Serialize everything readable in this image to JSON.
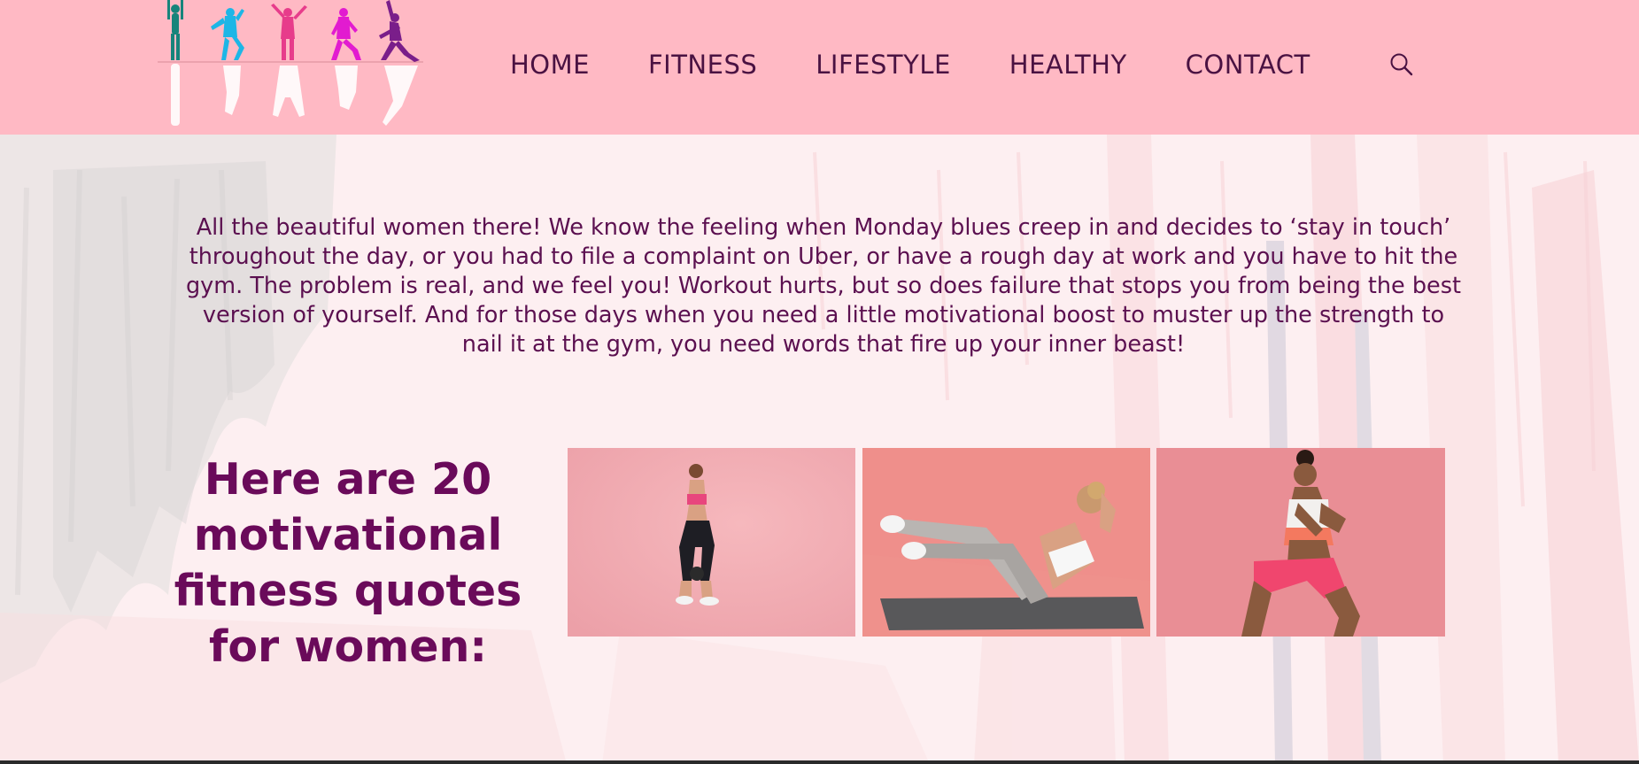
{
  "header": {
    "nav": [
      "HOME",
      "FITNESS",
      "LIFESTYLE",
      "HEALTHY",
      "CONTACT"
    ],
    "search_icon": "search-icon",
    "logo_icon": "fitness-silhouettes-logo"
  },
  "intro": {
    "text": "All the beautiful women there! We know the feeling when Monday blues creep in and decides to ‘stay in touch’ throughout the day, or you had to file a complaint on Uber, or have a rough day at work and you have to hit the gym. The problem is real, and we feel you! Workout hurts, but so does failure that stops you from being the best version of yourself. And for those days when you need a little motivational boost to muster up the strength to nail it at the gym, you need words that fire up your inner beast!"
  },
  "heading": {
    "text": "Here are 20 motivational fitness quotes for women:"
  },
  "colors": {
    "header_bg": "#ffb9c4",
    "text": "#5b1050",
    "heading": "#6a0a5a"
  }
}
